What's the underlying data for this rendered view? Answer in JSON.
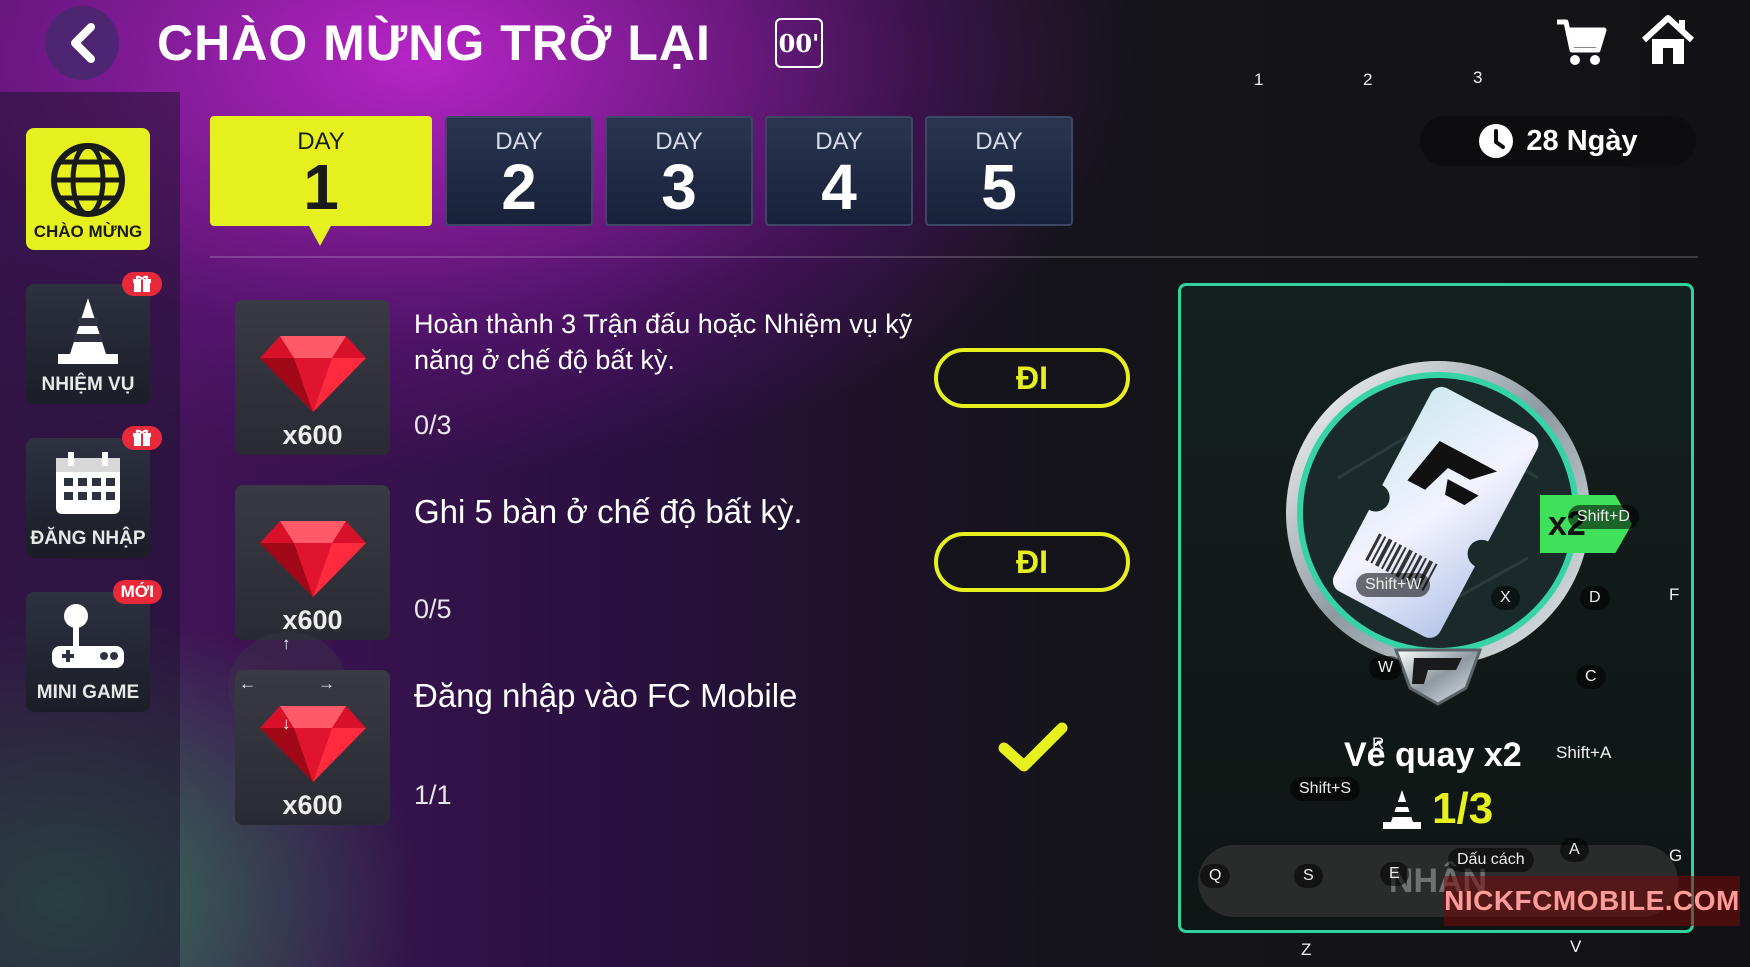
{
  "header": {
    "title": "CHÀO MỪNG TRỞ LẠI",
    "timer_badge": "00'",
    "icons": [
      "back-arrow-icon",
      "cart-icon",
      "home-icon"
    ]
  },
  "sidebar": {
    "items": [
      {
        "label": "CHÀO MỪNG",
        "icon": "globe-icon",
        "active": true
      },
      {
        "label": "NHIỆM VỤ",
        "icon": "cone-icon",
        "badge": "gift"
      },
      {
        "label": "ĐĂNG NHẬP",
        "icon": "calendar-icon",
        "badge": "gift"
      },
      {
        "label": "MINI GAME",
        "icon": "joystick-icon",
        "badge": "MỚI"
      }
    ]
  },
  "days": {
    "label": "DAY",
    "numbers": [
      "1",
      "2",
      "3",
      "4",
      "5"
    ],
    "active_index": 0,
    "remaining": "28 Ngày"
  },
  "missions": [
    {
      "text": "Hoàn thành 3 Trận đấu hoặc Nhiệm vụ kỹ năng ở chế độ bất kỳ.",
      "progress": "0/3",
      "reward_qty": "x600",
      "action": "ĐI",
      "state": "open"
    },
    {
      "text": "Ghi 5 bàn ở chế độ bất kỳ.",
      "progress": "0/5",
      "reward_qty": "x600",
      "action": "ĐI",
      "state": "open"
    },
    {
      "text": "Đăng nhập vào FC Mobile",
      "progress": "1/1",
      "reward_qty": "x600",
      "action": "",
      "state": "done"
    }
  ],
  "reward_panel": {
    "multiplier_tag": "x2",
    "prize_name": "Vé quay x2",
    "count": "1/3",
    "claim_label": "NHẬN"
  },
  "watermark": "NICKFCMOBILE.COM",
  "key_overlays": {
    "top_numbers": [
      "1",
      "2",
      "3"
    ],
    "shift_d": "Shift+D",
    "shift_w": "Shift+W",
    "x": "X",
    "d": "D",
    "f": "F",
    "w": "W",
    "c": "C",
    "r": "R",
    "shift_a": "Shift+A",
    "shift_s": "Shift+S",
    "a": "A",
    "g": "G",
    "q": "Q",
    "s": "S",
    "e": "E",
    "space": "Dấu cách",
    "z": "Z",
    "v": "V",
    "arrow_up": "↑",
    "arrow_left": "←",
    "arrow_right": "→",
    "arrow_down": "↓"
  },
  "colors": {
    "accent_yellow": "#e6f01f",
    "panel_border": "#2fd39b",
    "badge_red": "#e8293a",
    "ruby": "#d8102a"
  }
}
